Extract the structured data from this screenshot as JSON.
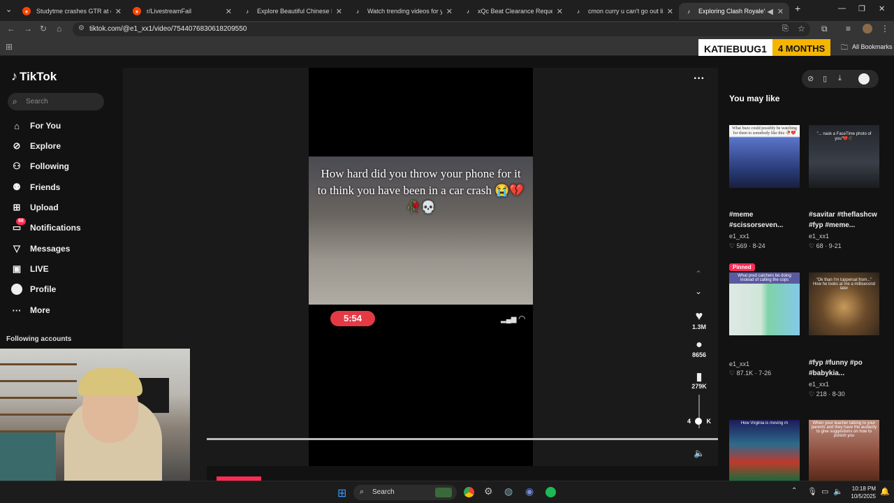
{
  "browser": {
    "tabs": [
      {
        "title": "Studytme crashes GTR at car m",
        "icon": "reddit-icon",
        "active": false
      },
      {
        "title": "r/LivestreamFail",
        "icon": "reddit-icon",
        "active": false
      },
      {
        "title": "Explore Beautiful Chinese Hairs",
        "icon": "tiktok-icon",
        "active": false
      },
      {
        "title": "Watch trending videos for you",
        "icon": "tiktok-icon",
        "active": false
      },
      {
        "title": "xQc Beat Clearance Request | T",
        "icon": "tiktok-icon",
        "active": false
      },
      {
        "title": "cmon curry u can't go out like",
        "icon": "tiktok-icon",
        "active": false
      },
      {
        "title": "Exploring Clash Royale's P",
        "icon": "tiktok-icon",
        "active": true
      }
    ],
    "url": "tiktok.com/@e1_xx1/video/7544076830618209550",
    "bookmarks_label": "All Bookmarks"
  },
  "sub_badge": {
    "name": "KATIEBUUG1",
    "duration": "4 MONTHS"
  },
  "tiktok": {
    "logo": "TikTok",
    "search_placeholder": "Search",
    "nav": [
      {
        "label": "For You",
        "icon": "home-icon"
      },
      {
        "label": "Explore",
        "icon": "compass-icon"
      },
      {
        "label": "Following",
        "icon": "following-icon"
      },
      {
        "label": "Friends",
        "icon": "friends-icon"
      },
      {
        "label": "Upload",
        "icon": "upload-icon"
      },
      {
        "label": "Notifications",
        "icon": "inbox-icon"
      },
      {
        "label": "Messages",
        "icon": "messages-icon"
      },
      {
        "label": "LIVE",
        "icon": "live-icon"
      },
      {
        "label": "Profile",
        "icon": "profile-icon"
      },
      {
        "label": "More",
        "icon": "more-icon"
      }
    ],
    "notifications_badge": "98",
    "following_accounts": "Following accounts",
    "video": {
      "caption": "How hard did you throw your phone for it to think you have been in a car crash 😭💔🥀💀",
      "clock": "5:54"
    },
    "actions": {
      "likes": "1.3M",
      "comments": "8656",
      "saves": "279K",
      "shares": "4",
      "shares_suffix": "K"
    },
    "you_may_like": "You may like",
    "recommendations": [
      {
        "title": "#meme #scissorseven...",
        "author": "e1_xx1",
        "likes": "569",
        "date": "8-24",
        "pinned": false,
        "thumb_text": "What buzz could possibly be watching for them to somebody like this 🥀❤️"
      },
      {
        "title": "#savitar #theflashcw #fyp #meme...",
        "author": "e1_xx1",
        "likes": "68",
        "date": "9-21",
        "pinned": false,
        "thumb_text": "\"... nask a FaceTime photo of you\"💔🥀"
      },
      {
        "title": "",
        "author": "e1_xx1",
        "likes": "87.1K",
        "date": "7-26",
        "pinned": true,
        "pinned_label": "Pinned",
        "thumb_text": "What pred catchers be doing instead of calling the cops"
      },
      {
        "title": "#fyp #funny #po #babykia...",
        "author": "e1_xx1",
        "likes": "218",
        "date": "8-30",
        "pinned": false,
        "thumb_text": "\"Ok than I'm tuppersal from...\" How he looks at me a millisecond later"
      },
      {
        "title": "",
        "author": "",
        "likes": "",
        "date": "",
        "pinned": false,
        "thumb_text": "How Virginia is moving rn"
      },
      {
        "title": "",
        "author": "",
        "likes": "",
        "date": "",
        "pinned": false,
        "thumb_text": "When your teacher talking to your parents and they have the audacity to give suggestions on how to punish you"
      }
    ]
  },
  "taskbar": {
    "search": "Search",
    "time": "10:18 PM",
    "date": "10/5/2025"
  }
}
